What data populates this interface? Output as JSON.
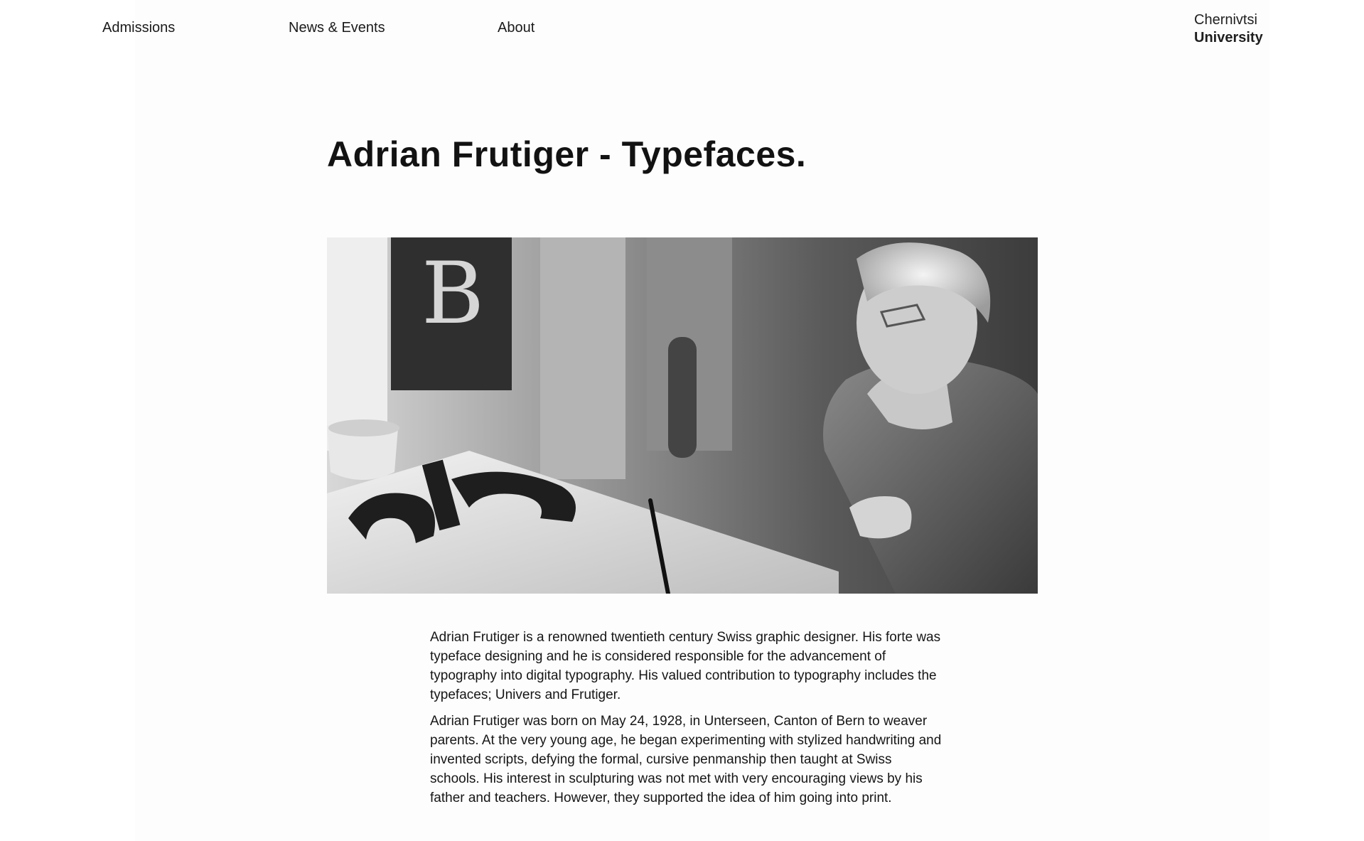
{
  "nav": {
    "items": [
      {
        "label": "Admissions"
      },
      {
        "label": "News & Events"
      },
      {
        "label": "About"
      }
    ]
  },
  "brand": {
    "line1": "Chernivtsi",
    "line2": "University"
  },
  "article": {
    "title": "Adrian Frutiger - Typefaces.",
    "hero_image": {
      "letters_visible": [
        "B",
        "a",
        "b"
      ]
    },
    "paragraphs": [
      "Adrian Frutiger is a renowned twentieth century Swiss graphic designer. His forte was typeface designing and he is considered responsible for the advancement of typography into digital typography. His valued contribution to typography includes the typefaces; Univers and Frutiger.",
      "Adrian Frutiger was born on May 24, 1928, in Unterseen, Canton of Bern to weaver parents. At the very young age, he began experimenting with stylized handwriting and invented scripts, defying the formal, cursive penmanship then taught at Swiss schools. His interest in sculpturing was not met with very encouraging views by his father and teachers. However, they supported the idea of him going into print."
    ]
  }
}
